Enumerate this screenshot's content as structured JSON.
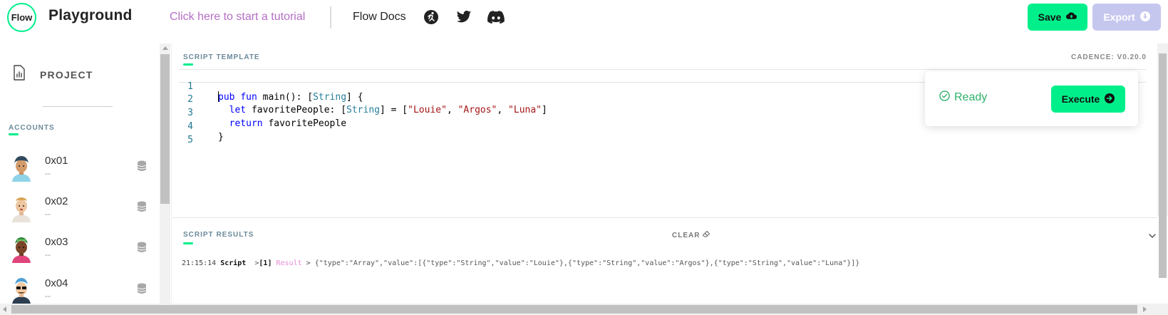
{
  "header": {
    "logo_text": "Flow",
    "title": "Playground",
    "tutorial_link": "Click here to start a tutorial",
    "docs_link": "Flow Docs",
    "social_icons": [
      "runner-icon",
      "twitter-icon",
      "discord-icon"
    ],
    "save_label": "Save",
    "export_label": "Export"
  },
  "sidebar": {
    "project_label": "PROJECT",
    "accounts_label": "ACCOUNTS",
    "accounts": [
      {
        "address": "0x01",
        "subtitle": "--"
      },
      {
        "address": "0x02",
        "subtitle": "--"
      },
      {
        "address": "0x03",
        "subtitle": "--"
      },
      {
        "address": "0x04",
        "subtitle": "--"
      }
    ]
  },
  "editor": {
    "section_title": "SCRIPT TEMPLATE",
    "cadence_version": "CADENCE: V0.20.0",
    "line_numbers": [
      "1",
      "2",
      "3",
      "4",
      "5"
    ]
  },
  "status": {
    "ready_label": "Ready",
    "execute_label": "Execute"
  },
  "results": {
    "section_title": "SCRIPT RESULTS",
    "clear_label": "CLEAR",
    "log": {
      "time": "21:15:14",
      "type": "Script",
      "arrow1": ">",
      "index": "[1]",
      "tag": "Result",
      "arrow2": ">",
      "value": "{\"type\":\"Array\",\"value\":[{\"type\":\"String\",\"value\":\"Louie\"},{\"type\":\"String\",\"value\":\"Argos\"},{\"type\":\"String\",\"value\":\"Luna\"}]}"
    }
  },
  "colors": {
    "accent": "#00ef8b",
    "export_button": "#c6c7ef",
    "tutorial_link": "#b56ec6",
    "ready": "#2fb26b",
    "result_tag": "#e58ad8"
  }
}
